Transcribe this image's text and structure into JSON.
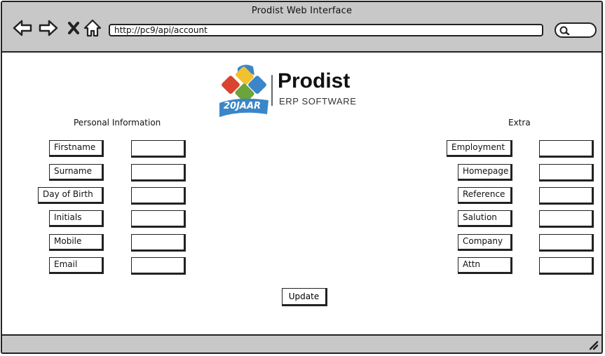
{
  "window": {
    "title": "Prodist Web Interface"
  },
  "browser": {
    "url": "http://pc9/api/account",
    "nav_icons": [
      "back-arrow-icon",
      "forward-arrow-icon",
      "close-x-icon",
      "home-icon"
    ]
  },
  "logo": {
    "brand": "Prodist",
    "tagline": "ERP SOFTWARE",
    "badge": "20JAAR"
  },
  "personal": {
    "title": "Personal Information",
    "fields": [
      {
        "label": "Firstname",
        "value": ""
      },
      {
        "label": "Surname",
        "value": ""
      },
      {
        "label": "Day of Birth",
        "value": ""
      },
      {
        "label": "Initials",
        "value": ""
      },
      {
        "label": "Mobile",
        "value": ""
      },
      {
        "label": "Email",
        "value": ""
      }
    ]
  },
  "extra": {
    "title": "Extra",
    "fields": [
      {
        "label": "Employment",
        "value": ""
      },
      {
        "label": "Homepage",
        "value": ""
      },
      {
        "label": "Reference",
        "value": ""
      },
      {
        "label": "Salution",
        "value": ""
      },
      {
        "label": "Company",
        "value": ""
      },
      {
        "label": "Attn",
        "value": ""
      }
    ]
  },
  "update_button": {
    "label": "Update"
  },
  "colors": {
    "chrome": "#c8c8c8",
    "outline": "#222222",
    "logo_red": "#d9432f",
    "logo_blue": "#3a86c8",
    "logo_green": "#6aa43a",
    "logo_yellow": "#f2c12e"
  }
}
